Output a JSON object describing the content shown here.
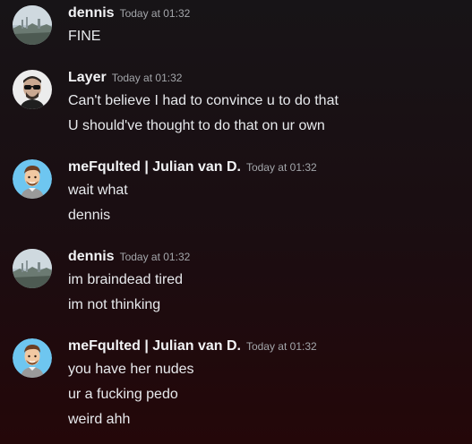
{
  "messages": [
    {
      "author": "dennis",
      "timestamp": "Today at 01:32",
      "avatar_icon": "landscape-avatar",
      "lines": [
        "FINE"
      ]
    },
    {
      "author": "Layer",
      "timestamp": "Today at 01:32",
      "avatar_icon": "sunglasses-man-avatar",
      "lines": [
        "Can't believe I had to convince u to do that",
        "U should've thought to do that on ur own"
      ]
    },
    {
      "author": "meFqulted | Julian van D.",
      "timestamp": "Today at 01:32",
      "avatar_icon": "cartoon-man-avatar",
      "lines": [
        "wait what",
        "dennis"
      ]
    },
    {
      "author": "dennis",
      "timestamp": "Today at 01:32",
      "avatar_icon": "landscape-avatar",
      "lines": [
        "im braindead tired",
        "im not thinking"
      ]
    },
    {
      "author": "meFqulted | Julian van D.",
      "timestamp": "Today at 01:32",
      "avatar_icon": "cartoon-man-avatar",
      "lines": [
        "you have her nudes",
        "ur a fucking pedo",
        "weird ahh"
      ]
    }
  ],
  "colors": {
    "username": "#f2f3f5",
    "timestamp": "#a3a6aa",
    "message_text": "#e7e9ec",
    "avatar_bg_cartoon": "#6ec6f0"
  }
}
